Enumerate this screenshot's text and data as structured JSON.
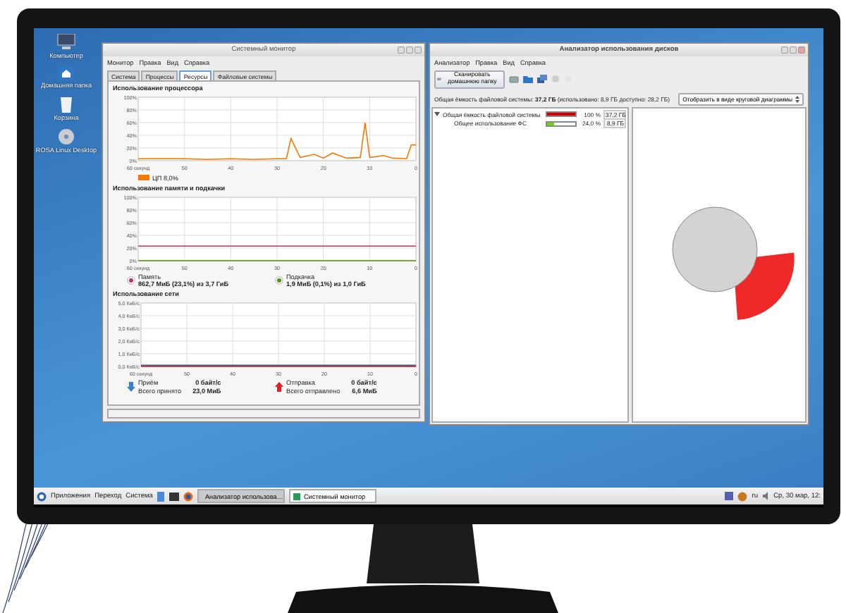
{
  "desktop_icons": [
    {
      "kind": "computer",
      "label": "Компьютер"
    },
    {
      "kind": "home",
      "label": "Домашняя папка"
    },
    {
      "kind": "trash",
      "label": "Корзина"
    },
    {
      "kind": "disc",
      "label": "ROSA Linux Desktop"
    }
  ],
  "system_monitor": {
    "title": "Системный монитор",
    "menu": [
      "Монитор",
      "Правка",
      "Вид",
      "Справка"
    ],
    "tabs": [
      {
        "label": "Система",
        "selected": false
      },
      {
        "label": "Процессы",
        "selected": false
      },
      {
        "label": "Ресурсы",
        "selected": true
      },
      {
        "label": "Файловые системы",
        "selected": false
      }
    ],
    "cpu": {
      "heading": "Использование процессора",
      "legend": "ЦП 8,0%",
      "chart_data": {
        "type": "line",
        "x": [
          60,
          55,
          50,
          45,
          40,
          35,
          30,
          28,
          27,
          25,
          22,
          20,
          18,
          15,
          12,
          11,
          10,
          7,
          5,
          2,
          1,
          0
        ],
        "xlim": [
          60,
          0
        ],
        "ylim": [
          0,
          100
        ],
        "grid": true,
        "series": [
          {
            "color": "#f57900",
            "values": [
              3,
              3,
              3,
              2,
              3,
              2,
              3,
              3,
              35,
              5,
              10,
              4,
              12,
              4,
              5,
              60,
              5,
              8,
              4,
              3,
              25,
              25
            ]
          }
        ],
        "xticks": [
          {
            "value": 60,
            "label": "60 секунд"
          },
          50,
          40,
          30,
          20,
          10,
          0
        ],
        "yticks": [
          {
            "value": 0,
            "label": "0%"
          },
          {
            "value": 20,
            "label": "20%"
          },
          {
            "value": 40,
            "label": "40%"
          },
          {
            "value": 60,
            "label": "60%"
          },
          {
            "value": 80,
            "label": "80%"
          },
          {
            "value": 100,
            "label": "100%"
          }
        ]
      }
    },
    "memory": {
      "heading": "Использование памяти и подкачки",
      "chart_data": {
        "type": "line",
        "x": [
          60,
          0
        ],
        "xlim": [
          60,
          0
        ],
        "ylim": [
          0,
          100
        ],
        "grid": true,
        "series": [
          {
            "color": "#c0306a",
            "values": [
              23,
              23
            ]
          },
          {
            "color": "#4e9a06",
            "values": [
              0,
              0
            ]
          }
        ],
        "xticks": [
          {
            "value": 60,
            "label": "60 секунд"
          },
          50,
          40,
          30,
          20,
          10,
          0
        ],
        "yticks": [
          {
            "value": 0,
            "label": "0%"
          },
          {
            "value": 20,
            "label": "20%"
          },
          {
            "value": 40,
            "label": "40%"
          },
          {
            "value": 60,
            "label": "60%"
          },
          {
            "value": 80,
            "label": "80%"
          },
          {
            "value": 100,
            "label": "100%"
          }
        ]
      },
      "items": [
        {
          "label": "Память",
          "value": "862,7 МиБ (23,1%) из 3,7 ГиБ",
          "color": "#c0306a"
        },
        {
          "label": "Подкачка",
          "value": "1,9 МиБ (0,1%) из 1,0 ГиБ",
          "color": "#4e9a06"
        }
      ]
    },
    "network": {
      "heading": "Использование сети",
      "chart_data": {
        "type": "line",
        "x": [
          60,
          0
        ],
        "xlim": [
          60,
          0
        ],
        "ylim": [
          0,
          5
        ],
        "grid": true,
        "series": [
          {
            "color": "#3465a4",
            "values": [
              0.1,
              0.1
            ]
          },
          {
            "color": "#cc0000",
            "values": [
              0,
              0
            ]
          }
        ],
        "xticks": [
          {
            "value": 60,
            "label": "60 секунд"
          },
          50,
          40,
          30,
          20,
          10,
          0
        ],
        "yticks": [
          {
            "value": 0,
            "label": "0,0 КиБ/с"
          },
          {
            "value": 1,
            "label": "1,0 КиБ/с"
          },
          {
            "value": 2,
            "label": "2,0 КиБ/с"
          },
          {
            "value": 3,
            "label": "3,0 КиБ/с"
          },
          {
            "value": 4,
            "label": "4,0 КиБ/с"
          },
          {
            "value": 5,
            "label": "5,0 КиБ/с"
          }
        ]
      },
      "items": [
        {
          "kind": "receive",
          "label": "Приём",
          "rate": "0 байт/с",
          "total_label": "Всего принято",
          "total": "23,0 МиБ"
        },
        {
          "kind": "send",
          "label": "Отправка",
          "rate": "0 байт/с",
          "total_label": "Всего отправлено",
          "total": "6,6 МиБ"
        }
      ]
    }
  },
  "disk_analyzer": {
    "title": "Анализатор использования дисков",
    "menu": [
      "Анализатор",
      "Правка",
      "Вид",
      "Справка"
    ],
    "scan_button": "Сканировать домашнюю папку",
    "info": "Общая ёмкость файловой системы: **37,2 ГБ** (использовано: 8,9 ГБ доступно: 28,2 ГБ)",
    "view_select": "Отобразить в виде круговой диаграммы",
    "rows": [
      {
        "name": "Общая ёмкость файловой системы",
        "level": 1,
        "percent": "100 %",
        "size": "37,2 ГБ",
        "color": "#cc0000",
        "expanded": true,
        "children": [
          {
            "name": "Общее использование ФС",
            "level": 0.24,
            "percent": "24,0 %",
            "size": "8,9 ГБ",
            "color": "#73d216"
          }
        ]
      }
    ]
  },
  "taskbar": {
    "menu": [
      "Приложения",
      "Переход",
      "Система"
    ],
    "tasks": [
      {
        "label": "Анализатор использова…",
        "selected": true
      },
      {
        "label": "Системный монитор",
        "selected": false
      }
    ],
    "layout": "ru",
    "clock": "Ср, 30 мар, 12:"
  }
}
